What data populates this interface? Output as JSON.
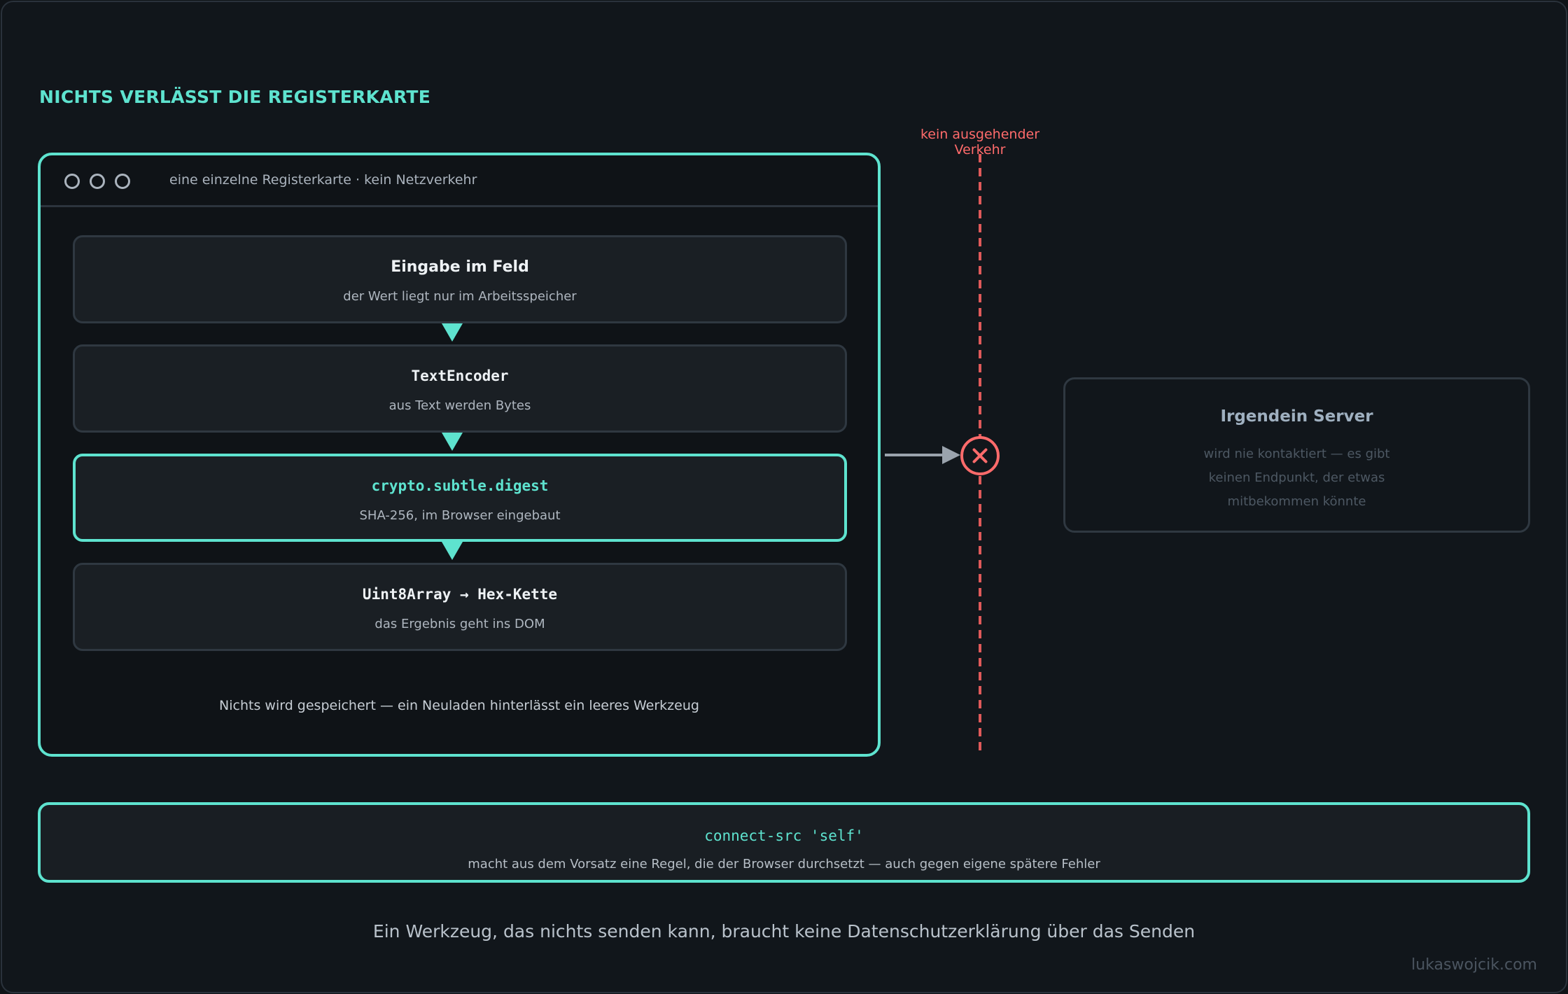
{
  "heading": "NICHTS VERLÄSST DIE REGISTERKARTE",
  "browser": {
    "caption": "eine einzelne Registerkarte · kein Netzverkehr",
    "steps": [
      {
        "title": "Eingabe im Feld",
        "subtitle": "der Wert liegt nur im Arbeitsspeicher"
      },
      {
        "title": "TextEncoder",
        "subtitle": "aus Text werden Bytes"
      },
      {
        "title": "crypto.subtle.digest",
        "subtitle": "SHA-256, im Browser eingebaut"
      },
      {
        "title": "Uint8Array → Hex-Kette",
        "subtitle": "das Ergebnis geht ins DOM"
      }
    ],
    "footer": "Nichts wird gespeichert — ein Neuladen hinterlässt ein leeres Werkzeug"
  },
  "boundary": {
    "label": "kein ausgehender Verkehr"
  },
  "server": {
    "title": "Irgendein Server",
    "lines": [
      "wird nie kontaktiert — es gibt",
      "keinen Endpunkt, der etwas",
      "mitbekommen könnte"
    ]
  },
  "policy": {
    "code": "connect-src 'self'",
    "description": "macht aus dem Vorsatz eine Regel, die der Browser durchsetzt — auch gegen eigene spätere Fehler"
  },
  "tagline": "Ein Werkzeug, das nichts senden kann, braucht keine Datenschutzerklärung über das Senden",
  "watermark": "lukaswojcik.com",
  "colors": {
    "accent": "#5ee3cf",
    "danger": "#ff6b6b",
    "background": "#11161b",
    "muted": "#4d5863"
  }
}
